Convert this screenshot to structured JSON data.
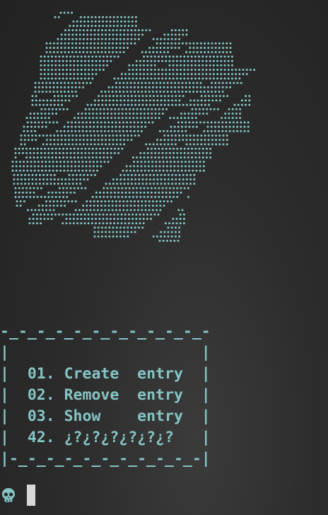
{
  "colors": {
    "text": "#86c4c4",
    "background": "#2b2b2b",
    "cursor": "#d8d8d8"
  },
  "art": {
    "description_icon": "dotted-ascii-logo"
  },
  "menu": {
    "lines": [
      "-_-_-_-_-_-_-_-_-_-_-_-",
      "|                     |",
      "|  01. Create  entry  |",
      "|  02. Remove  entry  |",
      "|  03. Show    entry  |",
      "|  42. ¿?¿?¿?¿?¿?¿?   |",
      "|-_-_-_-_-_-_-_-_-_-_-|"
    ]
  },
  "prompt": {
    "icon": "skull-icon"
  }
}
